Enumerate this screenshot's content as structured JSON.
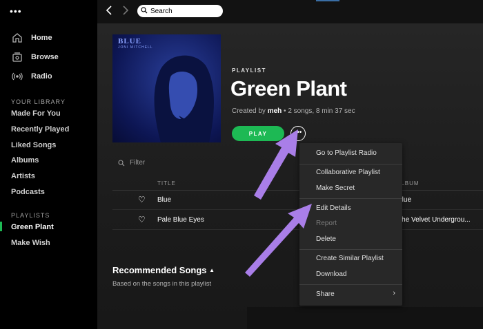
{
  "window": {
    "menu_dots": "•••"
  },
  "sidebar": {
    "nav": [
      {
        "label": "Home",
        "icon": "home-icon"
      },
      {
        "label": "Browse",
        "icon": "browse-icon"
      },
      {
        "label": "Radio",
        "icon": "radio-icon"
      }
    ],
    "library_heading": "YOUR LIBRARY",
    "library_items": [
      "Made For You",
      "Recently Played",
      "Liked Songs",
      "Albums",
      "Artists",
      "Podcasts"
    ],
    "playlists_heading": "PLAYLISTS",
    "playlists": [
      "Green Plant",
      "Make Wish"
    ],
    "active_playlist": "Green Plant"
  },
  "topbar": {
    "back": "‹",
    "forward": "›",
    "search_placeholder": "Search"
  },
  "playlist": {
    "cover": {
      "title": "BLUE",
      "artist": "JONI MITCHELL"
    },
    "type_label": "PLAYLIST",
    "title": "Green Plant",
    "meta_prefix": "Created by ",
    "owner": "meh",
    "meta_suffix": " • 2 songs, 8 min 37 sec",
    "play_label": "PLAY",
    "more_label": "•••"
  },
  "tracklist": {
    "filter_placeholder": "Filter",
    "columns": {
      "title": "TITLE",
      "album": "ALBUM"
    },
    "tracks": [
      {
        "title": "Blue",
        "album": "Blue"
      },
      {
        "title": "Pale Blue Eyes",
        "album": "The Velvet Undergrou..."
      }
    ]
  },
  "recommended": {
    "title": "Recommended Songs",
    "caret": "▲",
    "subtitle": "Based on the songs in this playlist"
  },
  "context_menu": {
    "items": [
      {
        "label": "Go to Playlist Radio"
      },
      {
        "label": "Collaborative Playlist"
      },
      {
        "label": "Make Secret"
      },
      {
        "label": "Edit Details"
      },
      {
        "label": "Report",
        "disabled": true
      },
      {
        "label": "Delete"
      },
      {
        "label": "Create Similar Playlist"
      },
      {
        "label": "Download"
      },
      {
        "label": "Share",
        "submenu": true
      }
    ],
    "submenu_chevron": "›"
  },
  "colors": {
    "accent": "#1db954",
    "annotation_arrow": "#a97ee8",
    "sidebar_bg": "#000000",
    "menu_bg": "#282828"
  }
}
